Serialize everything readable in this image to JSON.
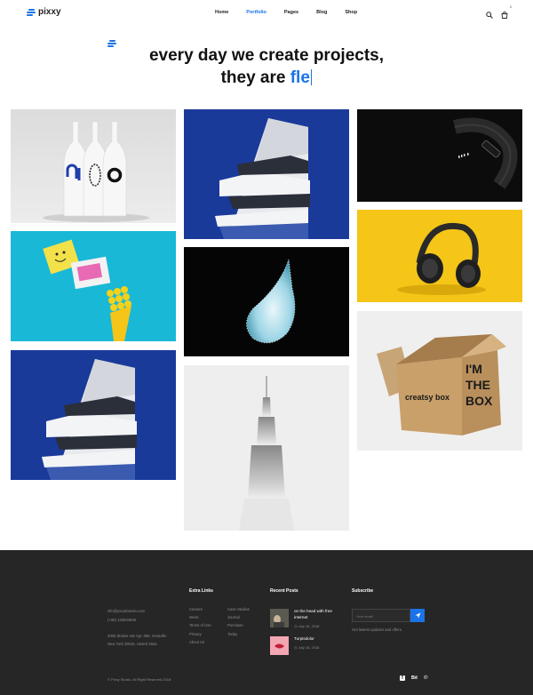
{
  "brand": {
    "name": "pixxy",
    "accent": "#1a73e8"
  },
  "nav": {
    "items": [
      {
        "label": "Home",
        "active": false
      },
      {
        "label": "Portfolio",
        "active": true
      },
      {
        "label": "Pages",
        "active": false
      },
      {
        "label": "Blog",
        "active": false
      },
      {
        "label": "Shop",
        "active": false
      }
    ]
  },
  "header": {
    "cart_count": "0",
    "icons": [
      "search-icon",
      "cart-icon"
    ]
  },
  "hero": {
    "line1": "every day we create projects,",
    "line2_prefix": "they are",
    "line2_typed": "fle"
  },
  "gallery": [
    {
      "name": "bottles-tile",
      "subject": "white bottles"
    },
    {
      "name": "building-tile",
      "subject": "white building blue sky"
    },
    {
      "name": "fitness-band-tile",
      "subject": "black fitness band"
    },
    {
      "name": "headphones-tile",
      "subject": "headphones on yellow"
    },
    {
      "name": "splash-tile",
      "subject": "water splash on black"
    },
    {
      "name": "brush-tile",
      "subject": "paint brush on cyan"
    },
    {
      "name": "building-tile-2",
      "subject": "white building blue sky"
    },
    {
      "name": "skyscraper-tile",
      "subject": "skyscraper in fog"
    },
    {
      "name": "box-tile",
      "subject": "cardboard box"
    }
  ],
  "box_text": {
    "line1": "I'M",
    "line2": "THE",
    "line3": "BOX",
    "brand": "creatsy box"
  },
  "footer": {
    "email": "info@yourdomain.com",
    "phone": "(+68) 120034509",
    "address1": "2005 Stokes Isle Apt. 896, Venaville",
    "address2": "New York 10010, United State",
    "extra_links_title": "Extra Links",
    "links_col1": [
      "Careers",
      "News",
      "Terms of Use",
      "Privacy",
      "About Us"
    ],
    "links_col2": [
      "Case Studios",
      "Journal",
      "Purchase",
      "Today"
    ],
    "recent_posts_title": "Recent Posts",
    "posts": [
      {
        "title1": "on the head with free",
        "title2": "internet",
        "date": "July 18, 2018"
      },
      {
        "title1": "Turpisdolor",
        "title2": "",
        "date": "July 18, 2018"
      }
    ],
    "subscribe_title": "Subscribe",
    "subscribe_placeholder": "Your email",
    "subscribe_note": "Get lastest updates and offers.",
    "copyright": "© Pixxy Studio. All Right Reserved 2018.",
    "social": [
      {
        "icon": "facebook-icon",
        "label": "f"
      },
      {
        "icon": "behance-icon",
        "label": "Bē"
      },
      {
        "icon": "pinterest-icon",
        "label": "℗"
      }
    ]
  }
}
